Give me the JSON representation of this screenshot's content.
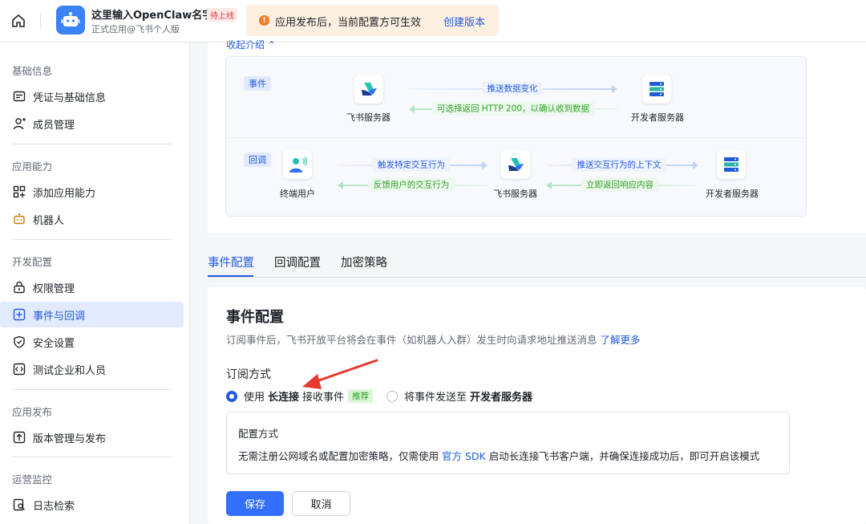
{
  "header": {
    "app_name": "这里输入OpenClaw名字",
    "app_status": "待上线",
    "app_sub": "正式应用@飞书个人版",
    "notice_text": "应用发布后，当前配置方可生效",
    "notice_link": "创建版本"
  },
  "sidebar": {
    "sections": [
      {
        "title": "基础信息",
        "items": [
          {
            "label": "凭证与基础信息",
            "icon": "credential-icon"
          },
          {
            "label": "成员管理",
            "icon": "member-icon"
          }
        ]
      },
      {
        "title": "应用能力",
        "items": [
          {
            "label": "添加应用能力",
            "icon": "grid-icon"
          },
          {
            "label": "机器人",
            "icon": "robot-icon"
          }
        ]
      },
      {
        "title": "开发配置",
        "items": [
          {
            "label": "权限管理",
            "icon": "lock-icon"
          },
          {
            "label": "事件与回调",
            "icon": "event-icon"
          },
          {
            "label": "安全设置",
            "icon": "shield-icon"
          },
          {
            "label": "测试企业和人员",
            "icon": "code-icon"
          }
        ]
      },
      {
        "title": "应用发布",
        "items": [
          {
            "label": "版本管理与发布",
            "icon": "upload-icon"
          }
        ]
      },
      {
        "title": "运营监控",
        "items": [
          {
            "label": "日志检索",
            "icon": "log-search-icon"
          }
        ]
      }
    ],
    "active": "事件与回调"
  },
  "flow": {
    "collapse_link": "收起介绍 ⌃",
    "event_tag": "事件",
    "callback_tag": "回调",
    "event_from": "飞书服务器",
    "event_to": "开发者服务器",
    "event_push": "推送数据变化",
    "event_return": "可选择返回 HTTP 200，以确认收到数据",
    "cb_user": "终端用户",
    "cb_mid": "飞书服务器",
    "cb_to": "开发者服务器",
    "cb_trigger": "触发特定交互行为",
    "cb_feedback": "反馈用户的交互行为",
    "cb_push_ctx": "推送交互行为的上下文",
    "cb_return": "立即返回响应内容"
  },
  "tabs": [
    "事件配置",
    "回调配置",
    "加密策略"
  ],
  "config": {
    "title": "事件配置",
    "desc": "订阅事件后，飞书开放平台将会在事件（如机器人入群）发生时向请求地址推送消息",
    "desc_link": "了解更多",
    "sub_label": "订阅方式",
    "option1_pre": "使用",
    "option1_bold": "长连接",
    "option1_post": "接收事件",
    "option1_badge": "推荐",
    "option2_pre": "将事件发送至",
    "option2_bold": "开发者服务器",
    "mode_title": "配置方式",
    "mode_text_pre": "无需注册公网域名或配置加密策略，仅需使用",
    "mode_link": "官方 SDK",
    "mode_text_post": "启动长连接飞书客户端，并确保连接成功后，即可开启该模式",
    "save": "保存",
    "cancel": "取消"
  },
  "colors": {
    "accent": "#245bdb",
    "primary_button": "#3370ff",
    "annotation_arrow": "#e5392f"
  }
}
